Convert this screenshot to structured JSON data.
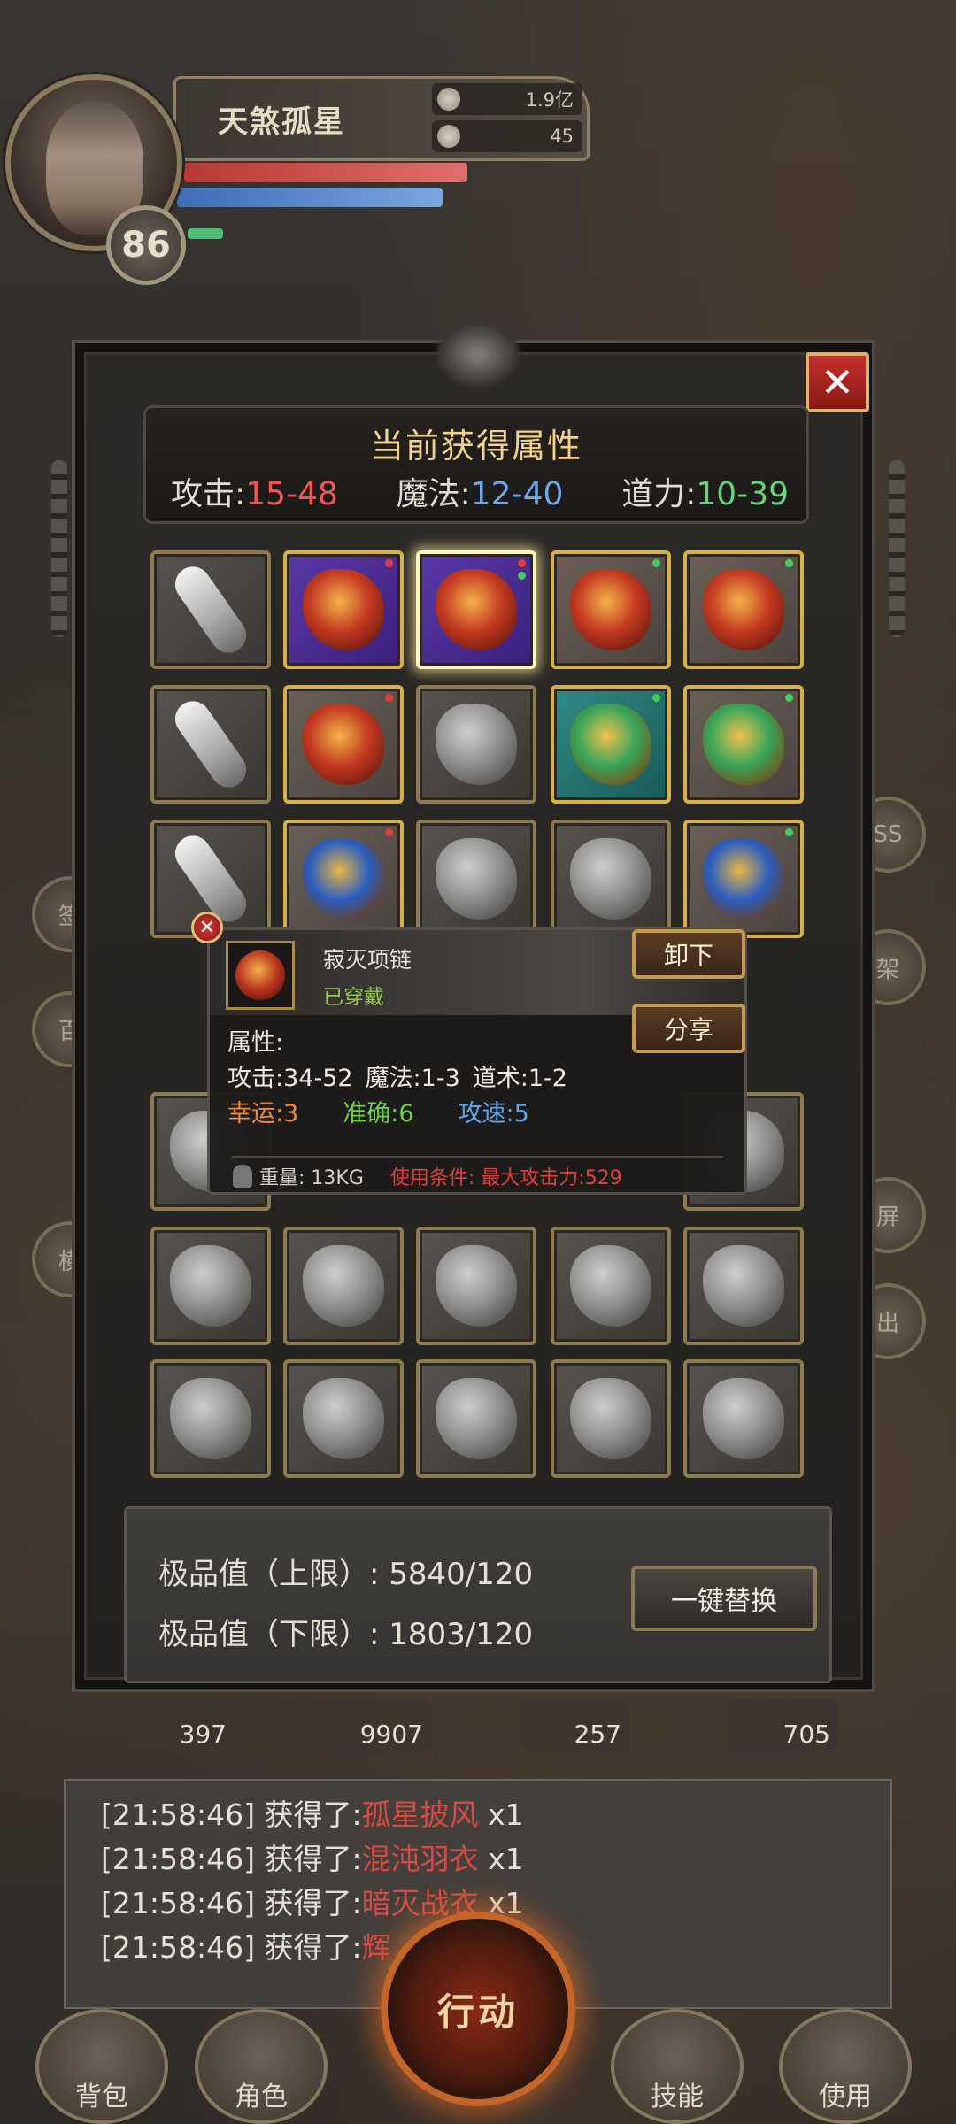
{
  "player": {
    "name": "天煞孤星",
    "level": "86",
    "gold": "1.9亿",
    "silver": "45"
  },
  "panel": {
    "title": "当前获得属性",
    "close_label": "✕",
    "attrs": [
      {
        "label": "攻击:",
        "value": "15-48",
        "color": "#f05656"
      },
      {
        "label": "魔法:",
        "value": "12-40",
        "color": "#6ca7e8"
      },
      {
        "label": "道力:",
        "value": "10-39",
        "color": "#63d47d"
      }
    ]
  },
  "tooltip": {
    "item_name": "寂灭项链",
    "state": "已穿戴",
    "unequip_label": "卸下",
    "share_label": "分享",
    "attr_heading": "属性:",
    "line1": [
      "攻击:34-52",
      "魔法:1-3",
      "道术:1-2"
    ],
    "luck": "幸运:3",
    "accuracy": "准确:6",
    "attack_speed": "攻速:5",
    "weight": "重量: 13KG",
    "requirement": "使用条件: 最大攻击力:529"
  },
  "stats": {
    "upper": "极品值（上限）: 5840/120",
    "lower": "极品值（下限）: 1803/120",
    "replace_label": "一键替换"
  },
  "quick_items": [
    "397",
    "9907",
    "257",
    "705"
  ],
  "log": [
    {
      "time": "[21:58:46] 获得了:",
      "item": "孤星披风",
      "qty": " x1"
    },
    {
      "time": "[21:58:46] 获得了:",
      "item": "混沌羽衣",
      "qty": " x1"
    },
    {
      "time": "[21:58:46] 获得了:",
      "item": "暗灭战衣",
      "qty": " x1"
    },
    {
      "time": "[21:58:46] 获得了:",
      "item": "辉",
      "qty": ""
    }
  ],
  "nav": {
    "bag": "背包",
    "character": "角色",
    "action": "行动",
    "skills": "技能",
    "use": "使用"
  }
}
